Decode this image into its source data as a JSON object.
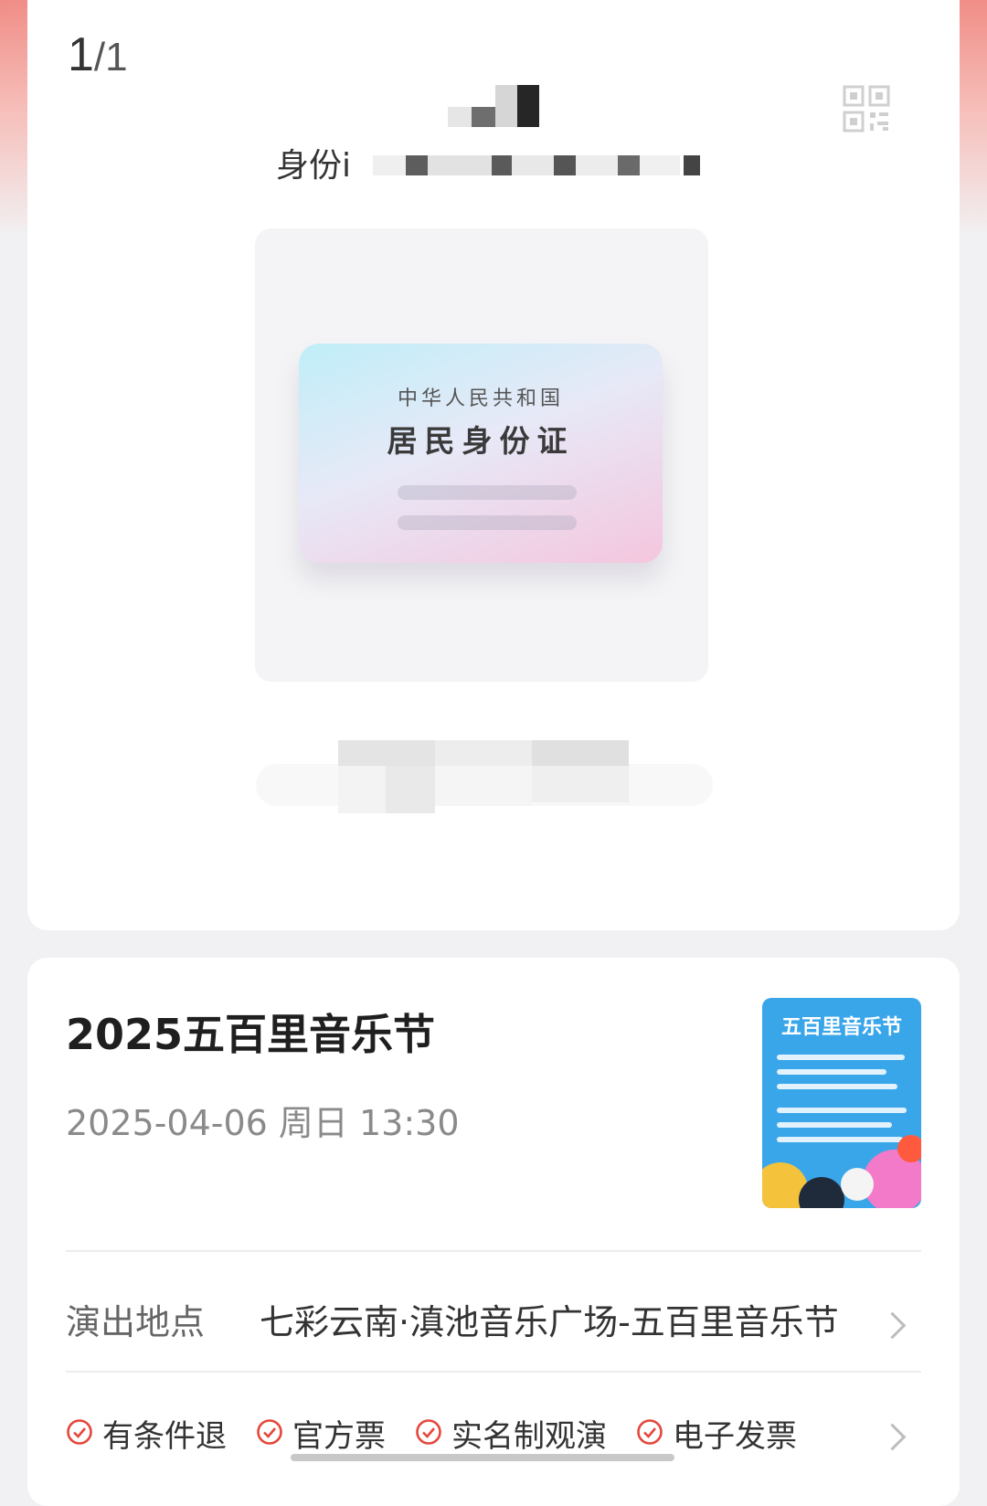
{
  "ticket": {
    "page_current": "1",
    "page_total": "/1",
    "id_type_label": "身份i",
    "id_card_country": "中华人民共和国",
    "id_card_title": "居民身份证"
  },
  "event": {
    "title": "2025五百里音乐节",
    "datetime": "2025-04-06 周日 13:30",
    "poster_title": "五百里音乐节",
    "venue_label": "演出地点",
    "venue_value": "七彩云南·滇池音乐广场-五百里音乐节",
    "features": [
      "有条件退",
      "官方票",
      "实名制观演",
      "电子发票"
    ]
  },
  "colors": {
    "accent_red": "#e5473b",
    "top_tint": "#f08d86",
    "poster_blue": "#3aa6ea"
  },
  "icons": [
    "qr-code-icon",
    "check-circle-icon",
    "chevron-right-icon"
  ]
}
